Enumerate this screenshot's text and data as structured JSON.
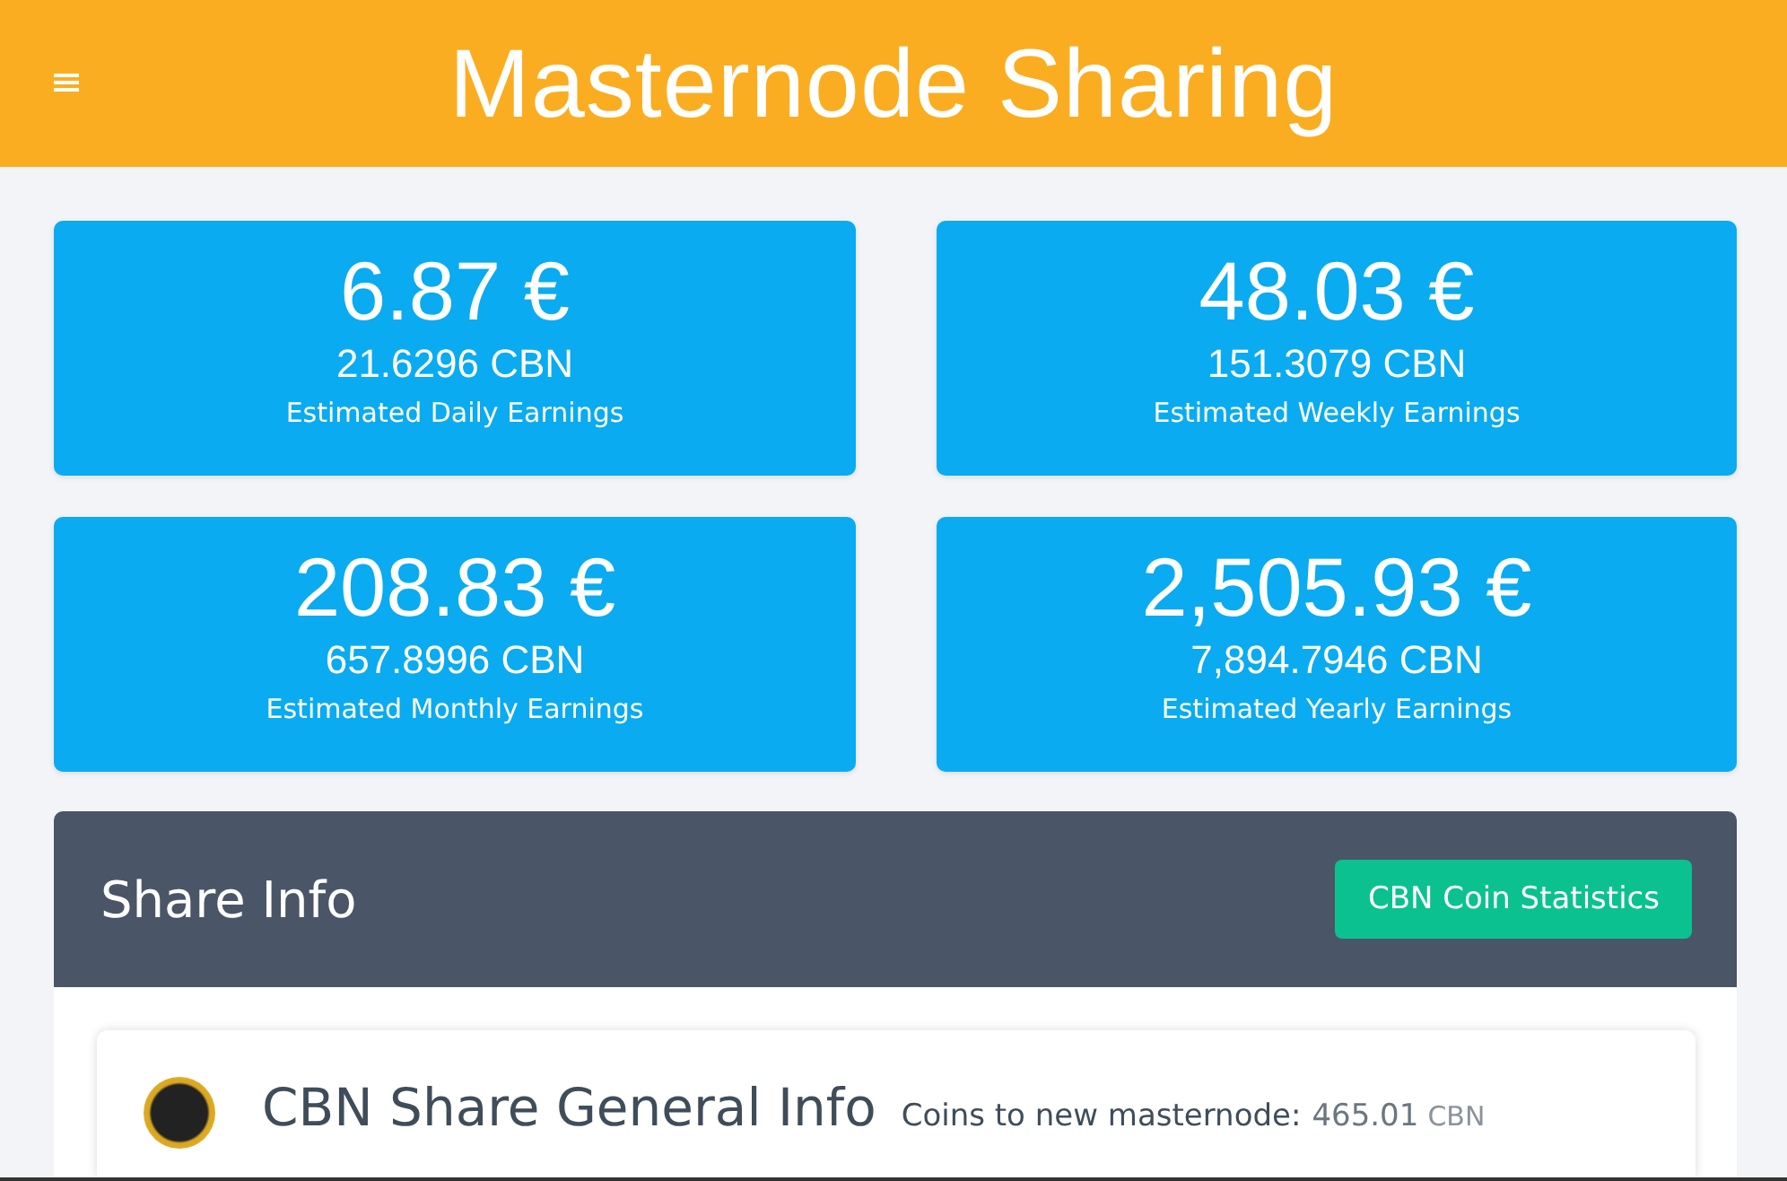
{
  "header": {
    "title": "Masternode Sharing"
  },
  "earnings": [
    {
      "fiat": "6.87 €",
      "coins": "21.6296 CBN",
      "label": "Estimated Daily Earnings"
    },
    {
      "fiat": "48.03 €",
      "coins": "151.3079 CBN",
      "label": "Estimated Weekly Earnings"
    },
    {
      "fiat": "208.83 €",
      "coins": "657.8996 CBN",
      "label": "Estimated Monthly Earnings"
    },
    {
      "fiat": "2,505.93 €",
      "coins": "7,894.7946 CBN",
      "label": "Estimated Yearly Earnings"
    }
  ],
  "share_info": {
    "title": "Share Info",
    "button": "CBN Coin Statistics",
    "general": {
      "title": "CBN Share General Info",
      "coins_label": "Coins to new masternode:",
      "coins_value": "465.01",
      "coins_unit": "CBN"
    }
  }
}
